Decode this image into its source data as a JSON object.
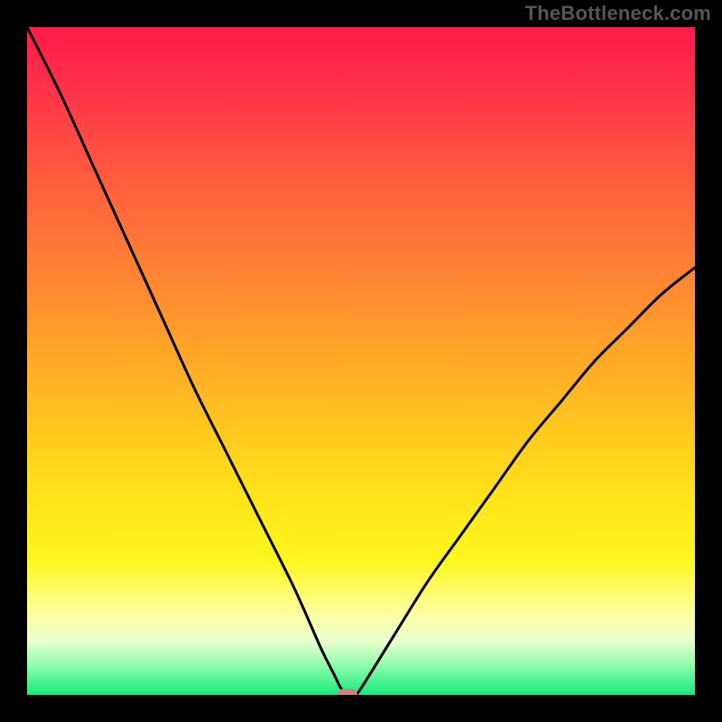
{
  "watermark": {
    "text": "TheBottleneck.com"
  },
  "chart_data": {
    "type": "line",
    "title": "",
    "xlabel": "",
    "ylabel": "",
    "x": [
      0,
      5,
      10,
      15,
      20,
      25,
      30,
      35,
      40,
      44,
      46,
      47,
      48,
      49,
      50,
      55,
      60,
      65,
      70,
      75,
      80,
      85,
      90,
      95,
      100
    ],
    "y": [
      100,
      90,
      79,
      68,
      57,
      46,
      36,
      26,
      16,
      7,
      3,
      1,
      0,
      0,
      1,
      9,
      17,
      24,
      31,
      38,
      44,
      50,
      55,
      60,
      64
    ],
    "xlim": [
      0,
      100
    ],
    "ylim": [
      0,
      100
    ],
    "marker": {
      "x": 48,
      "y": 0
    },
    "legend": false,
    "grid": false,
    "background": "rainbow-gradient",
    "curve_color": "#000000"
  }
}
